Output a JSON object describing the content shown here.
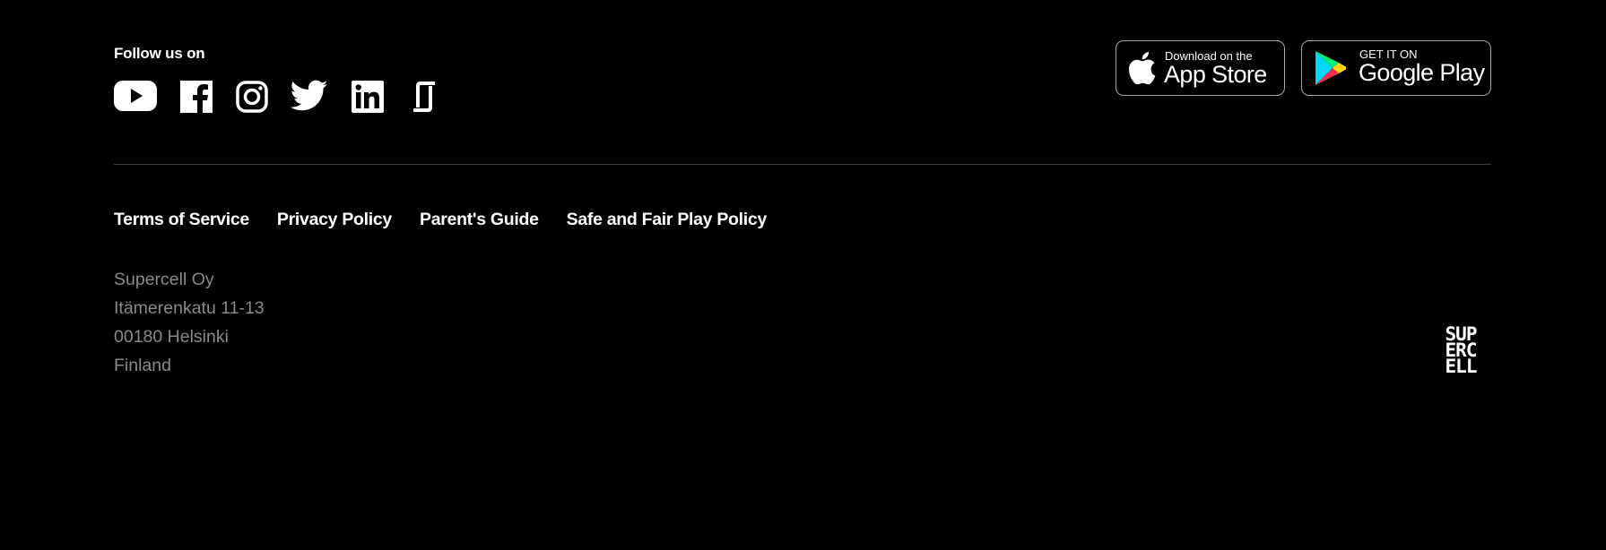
{
  "follow": {
    "label": "Follow us on",
    "icons": [
      "youtube-icon",
      "facebook-icon",
      "instagram-icon",
      "twitter-icon",
      "linkedin-icon",
      "glassdoor-icon"
    ]
  },
  "stores": {
    "apple": {
      "small": "Download on the",
      "big": "App Store",
      "icon": "apple-icon"
    },
    "google": {
      "small": "GET IT ON",
      "big": "Google Play",
      "icon": "google-play-icon"
    }
  },
  "legal_links": [
    "Terms of Service",
    "Privacy Policy",
    "Parent's Guide",
    "Safe and Fair Play Policy"
  ],
  "address": {
    "company": "Supercell Oy",
    "street": "Itämerenkatu 11-13",
    "city": "00180 Helsinki",
    "country": "Finland"
  },
  "logo": {
    "lines": [
      "SUP",
      "ERC",
      "ELL"
    ]
  },
  "colors": {
    "background": "#000000",
    "text": "#ffffff",
    "muted_text": "#8a8a8a",
    "divider": "#3a3a3a",
    "badge_border": "#a6a6a6"
  }
}
